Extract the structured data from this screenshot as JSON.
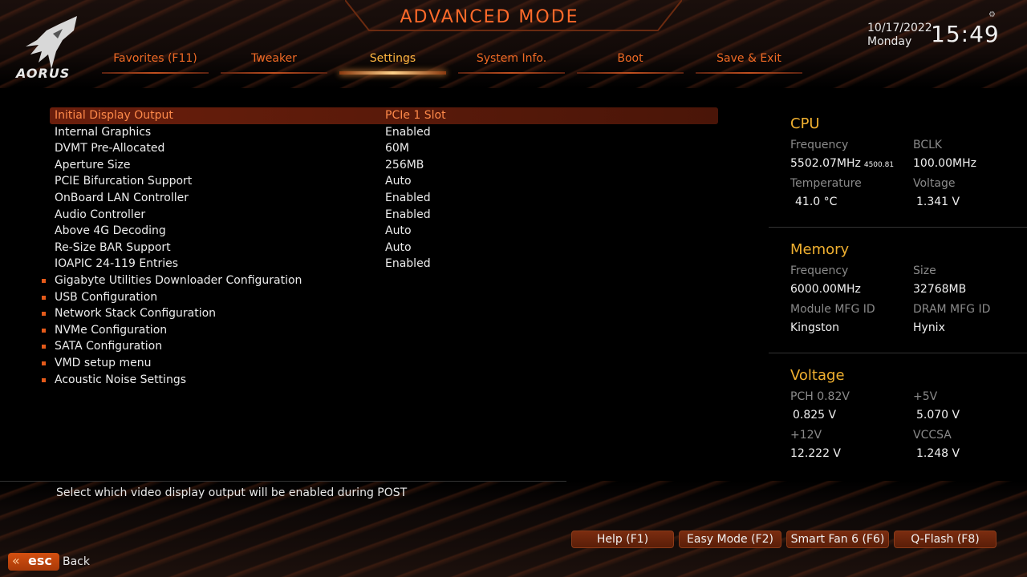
{
  "header": {
    "title": "ADVANCED MODE",
    "logo_text": "AORUS",
    "date": "10/17/2022",
    "day": "Monday",
    "time": "15:49",
    "gear_icon": "⚙"
  },
  "tabs": [
    {
      "label": "Favorites (F11)"
    },
    {
      "label": "Tweaker"
    },
    {
      "label": "Settings"
    },
    {
      "label": "System Info."
    },
    {
      "label": "Boot"
    },
    {
      "label": "Save & Exit"
    }
  ],
  "settings": [
    {
      "label": "Initial Display Output",
      "value": "PCIe 1 Slot"
    },
    {
      "label": "Internal Graphics",
      "value": "Enabled"
    },
    {
      "label": "DVMT Pre-Allocated",
      "value": "60M"
    },
    {
      "label": "Aperture Size",
      "value": "256MB"
    },
    {
      "label": "PCIE Bifurcation Support",
      "value": "Auto"
    },
    {
      "label": "OnBoard LAN Controller",
      "value": "Enabled"
    },
    {
      "label": "Audio Controller",
      "value": "Enabled"
    },
    {
      "label": "Above 4G Decoding",
      "value": "Auto"
    },
    {
      "label": "Re-Size BAR Support",
      "value": "Auto"
    },
    {
      "label": "IOAPIC 24-119 Entries",
      "value": "Enabled"
    }
  ],
  "submenus": [
    {
      "label": "Gigabyte Utilities Downloader Configuration"
    },
    {
      "label": "USB Configuration"
    },
    {
      "label": "Network Stack Configuration"
    },
    {
      "label": "NVMe Configuration"
    },
    {
      "label": "SATA Configuration"
    },
    {
      "label": "VMD setup menu"
    },
    {
      "label": "Acoustic Noise Settings"
    }
  ],
  "cpu": {
    "title": "CPU",
    "freq_label": "Frequency",
    "freq_value": "5502.07MHz",
    "freq_sub": "4500.81",
    "bclk_label": "BCLK",
    "bclk_value": "100.00MHz",
    "temp_label": "Temperature",
    "temp_value": "41.0 °C",
    "volt_label": "Voltage",
    "volt_value": "1.341 V"
  },
  "memory": {
    "title": "Memory",
    "freq_label": "Frequency",
    "freq_value": "6000.00MHz",
    "size_label": "Size",
    "size_value": "32768MB",
    "module_label": "Module MFG ID",
    "module_value": "Kingston",
    "dram_label": "DRAM MFG ID",
    "dram_value": "Hynix"
  },
  "voltage": {
    "title": "Voltage",
    "pch_label": "PCH 0.82V",
    "pch_value": "0.825 V",
    "p5v_label": "+5V",
    "p5v_value": "5.070 V",
    "p12v_label": "+12V",
    "p12v_value": "12.222 V",
    "vccsa_label": "VCCSA",
    "vccsa_value": "1.248 V"
  },
  "help_text": "Select which video display output will be enabled during POST",
  "buttons": [
    {
      "label": "Help (F1)"
    },
    {
      "label": "Easy Mode (F2)"
    },
    {
      "label": "Smart Fan 6 (F6)"
    },
    {
      "label": "Q-Flash (F8)"
    }
  ],
  "esc": {
    "arrow": "«",
    "label": "esc",
    "back": "Back"
  },
  "colors": {
    "accent": "#f06a25",
    "active_tab": "#ffb640",
    "section_title": "#f0b030",
    "selected_row": "#6a1e0c"
  }
}
